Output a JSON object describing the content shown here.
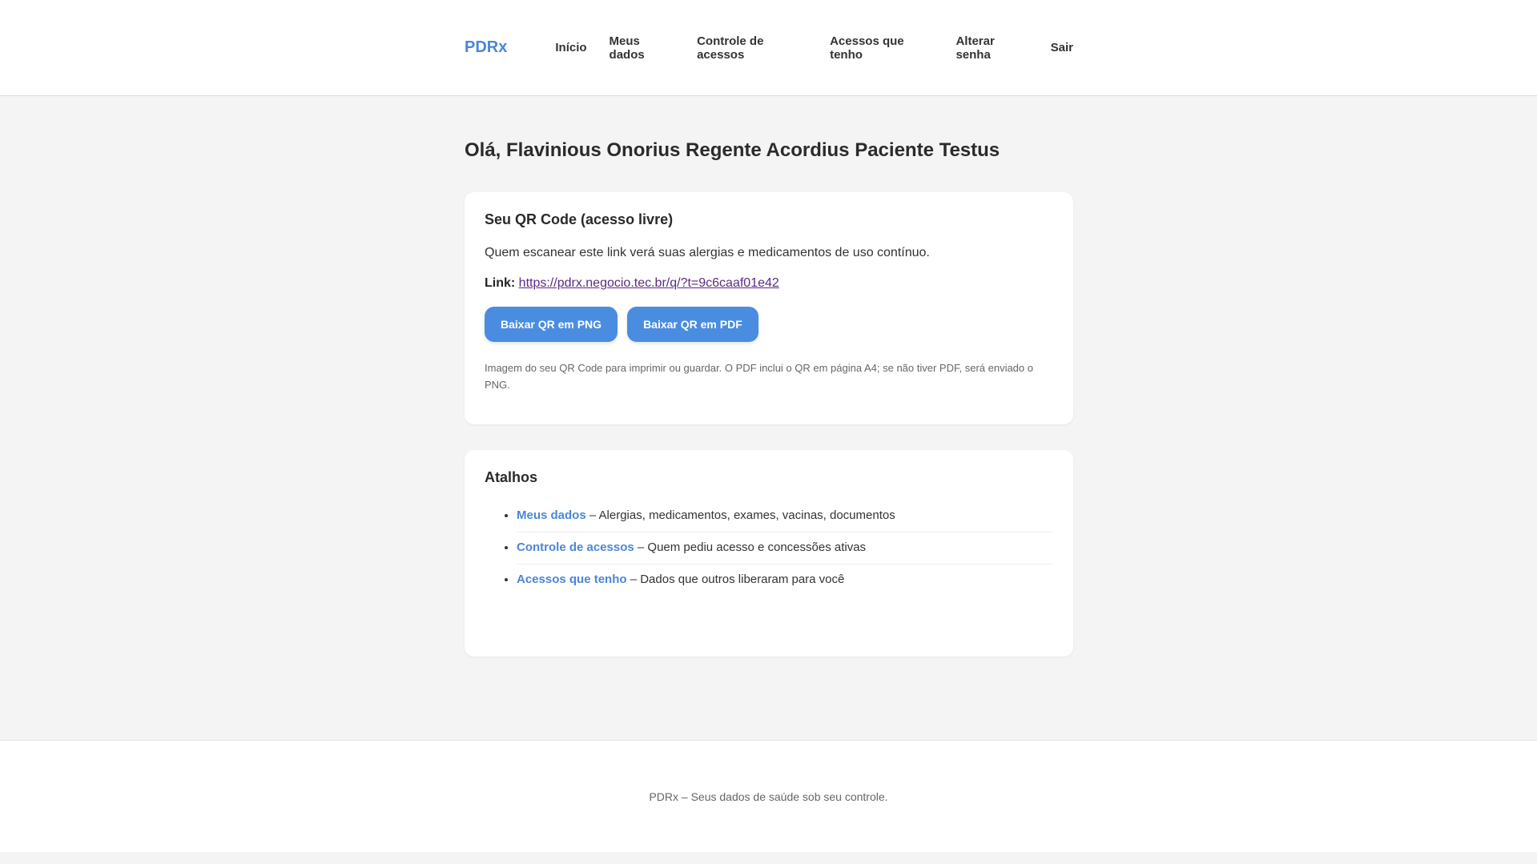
{
  "header": {
    "brand": "PDRx",
    "nav": [
      {
        "label": "Início"
      },
      {
        "label": "Meus dados"
      },
      {
        "label": "Controle de acessos"
      },
      {
        "label": "Acessos que tenho"
      },
      {
        "label": "Alterar senha"
      },
      {
        "label": "Sair"
      }
    ]
  },
  "main": {
    "greeting": "Olá, Flavinious Onorius Regente Acordius Paciente Testus",
    "qr_card": {
      "title": "Seu QR Code (acesso livre)",
      "description": "Quem escanear este link verá suas alergias e medicamentos de uso contínuo.",
      "link_label": "Link:",
      "link_url": "https://pdrx.negocio.tec.br/q/?t=9c6caaf01e42",
      "button_png": "Baixar QR em PNG",
      "button_pdf": "Baixar QR em PDF",
      "note": "Imagem do seu QR Code para imprimir ou guardar. O PDF inclui o QR em página A4; se não tiver PDF, será enviado o PNG."
    },
    "shortcuts_card": {
      "title": "Atalhos",
      "items": [
        {
          "link": "Meus dados",
          "text": " – Alergias, medicamentos, exames, vacinas, documentos"
        },
        {
          "link": "Controle de acessos",
          "text": " – Quem pediu acesso e concessões ativas"
        },
        {
          "link": "Acessos que tenho",
          "text": " – Dados que outros liberaram para você"
        }
      ]
    }
  },
  "footer": {
    "text": "PDRx – Seus dados de saúde sob seu controle."
  },
  "colors": {
    "accent": "#4a86d8",
    "button": "#4a8de0",
    "background": "#f4f4f4",
    "visited_link": "#5a2a86"
  }
}
